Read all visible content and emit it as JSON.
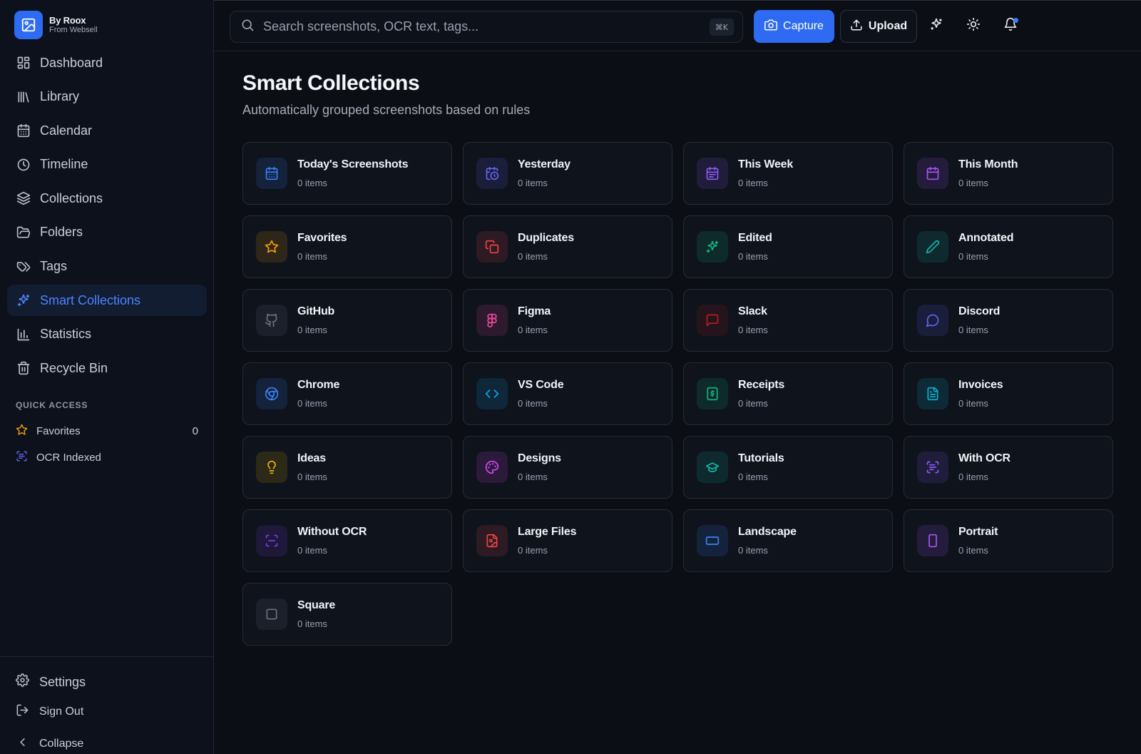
{
  "brand": {
    "name": "By Roox",
    "sub": "From Websell"
  },
  "nav": [
    {
      "label": "Dashboard",
      "icon": "dashboard-icon"
    },
    {
      "label": "Library",
      "icon": "library-icon"
    },
    {
      "label": "Calendar",
      "icon": "calendar-icon"
    },
    {
      "label": "Timeline",
      "icon": "clock-icon"
    },
    {
      "label": "Collections",
      "icon": "layers-icon"
    },
    {
      "label": "Folders",
      "icon": "folder-icon"
    },
    {
      "label": "Tags",
      "icon": "tags-icon"
    },
    {
      "label": "Smart Collections",
      "icon": "sparkles-icon",
      "active": true
    },
    {
      "label": "Statistics",
      "icon": "bar-chart-icon"
    },
    {
      "label": "Recycle Bin",
      "icon": "trash-icon"
    }
  ],
  "quick_access": {
    "label": "QUICK ACCESS",
    "items": [
      {
        "label": "Favorites",
        "count": "0",
        "icon": "star-icon"
      },
      {
        "label": "OCR Indexed",
        "icon": "scan-text-icon"
      }
    ]
  },
  "footer": {
    "settings": "Settings",
    "sign_out": "Sign Out",
    "collapse": "Collapse"
  },
  "search": {
    "placeholder": "Search screenshots, OCR text, tags...",
    "shortcut": "⌘K"
  },
  "toolbar": {
    "capture": "Capture",
    "upload": "Upload"
  },
  "page": {
    "title": "Smart Collections",
    "subtitle": "Automatically grouped screenshots based on rules"
  },
  "accent_color": "#2f6bf2",
  "collections": [
    {
      "title": "Today's Screenshots",
      "count": "0 items",
      "icon": "calendar-icon",
      "color": "#3b82f6"
    },
    {
      "title": "Yesterday",
      "count": "0 items",
      "icon": "calendar-clock-icon",
      "color": "#6366f1"
    },
    {
      "title": "This Week",
      "count": "0 items",
      "icon": "calendar-range-icon",
      "color": "#8b5cf6"
    },
    {
      "title": "This Month",
      "count": "0 items",
      "icon": "calendar-month-icon",
      "color": "#a855f7"
    },
    {
      "title": "Favorites",
      "count": "0 items",
      "icon": "star-icon",
      "color": "#f59e0b"
    },
    {
      "title": "Duplicates",
      "count": "0 items",
      "icon": "copy-icon",
      "color": "#ef4444"
    },
    {
      "title": "Edited",
      "count": "0 items",
      "icon": "sparkles-icon",
      "color": "#10b981"
    },
    {
      "title": "Annotated",
      "count": "0 items",
      "icon": "pencil-icon",
      "color": "#14b8a6"
    },
    {
      "title": "GitHub",
      "count": "0 items",
      "icon": "github-icon",
      "color": "#6b7280"
    },
    {
      "title": "Figma",
      "count": "0 items",
      "icon": "figma-icon",
      "color": "#ec4899"
    },
    {
      "title": "Slack",
      "count": "0 items",
      "icon": "message-square-icon",
      "color": "#b91c1c"
    },
    {
      "title": "Discord",
      "count": "0 items",
      "icon": "message-circle-icon",
      "color": "#6366f1"
    },
    {
      "title": "Chrome",
      "count": "0 items",
      "icon": "chrome-icon",
      "color": "#3b82f6"
    },
    {
      "title": "VS Code",
      "count": "0 items",
      "icon": "code-icon",
      "color": "#0ea5e9"
    },
    {
      "title": "Receipts",
      "count": "0 items",
      "icon": "receipt-icon",
      "color": "#10b981"
    },
    {
      "title": "Invoices",
      "count": "0 items",
      "icon": "file-text-icon",
      "color": "#06b6d4"
    },
    {
      "title": "Ideas",
      "count": "0 items",
      "icon": "lightbulb-icon",
      "color": "#eab308"
    },
    {
      "title": "Designs",
      "count": "0 items",
      "icon": "palette-icon",
      "color": "#d946ef"
    },
    {
      "title": "Tutorials",
      "count": "0 items",
      "icon": "graduation-cap-icon",
      "color": "#14b8a6"
    },
    {
      "title": "With OCR",
      "count": "0 items",
      "icon": "scan-text-icon",
      "color": "#8b5cf6"
    },
    {
      "title": "Without OCR",
      "count": "0 items",
      "icon": "scan-icon",
      "color": "#7c3aed"
    },
    {
      "title": "Large Files",
      "count": "0 items",
      "icon": "file-image-icon",
      "color": "#ef4444"
    },
    {
      "title": "Landscape",
      "count": "0 items",
      "icon": "rectangle-horizontal-icon",
      "color": "#3b82f6"
    },
    {
      "title": "Portrait",
      "count": "0 items",
      "icon": "rectangle-vertical-icon",
      "color": "#a855f7"
    },
    {
      "title": "Square",
      "count": "0 items",
      "icon": "square-icon",
      "color": "#6b7280"
    }
  ]
}
